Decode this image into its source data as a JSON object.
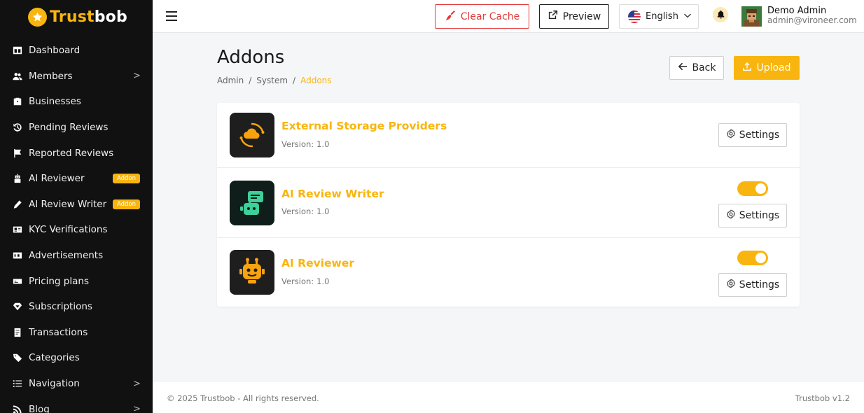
{
  "brand": {
    "part1": "Trust",
    "part2": "bob",
    "accent": "#f9b50f"
  },
  "sidebar": {
    "items": [
      {
        "label": "Dashboard",
        "icon": "dashboard-icon"
      },
      {
        "label": "Members",
        "icon": "members-icon",
        "chevron": ">"
      },
      {
        "label": "Businesses",
        "icon": "briefcase-icon"
      },
      {
        "label": "Pending Reviews",
        "icon": "history-icon"
      },
      {
        "label": "Reported Reviews",
        "icon": "flag-icon"
      },
      {
        "label": "AI Reviewer",
        "icon": "robot-icon",
        "badge": "Addon"
      },
      {
        "label": "AI Review Writer",
        "icon": "pen-icon",
        "badge": "Addon"
      },
      {
        "label": "KYC Verifications",
        "icon": "id-card-icon"
      },
      {
        "label": "Advertisements",
        "icon": "ad-icon"
      },
      {
        "label": "Pricing plans",
        "icon": "pricing-icon"
      },
      {
        "label": "Subscriptions",
        "icon": "diamond-icon"
      },
      {
        "label": "Transactions",
        "icon": "receipt-icon"
      },
      {
        "label": "Categories",
        "icon": "tags-icon"
      },
      {
        "label": "Navigation",
        "icon": "list-icon",
        "chevron": ">"
      },
      {
        "label": "Blog",
        "icon": "rss-icon",
        "chevron": ">"
      }
    ]
  },
  "topbar": {
    "clear_cache": "Clear Cache",
    "preview": "Preview",
    "language": "English",
    "user_name": "Demo Admin",
    "user_email": "admin@vironeer.com"
  },
  "page": {
    "title": "Addons",
    "breadcrumbs": [
      "Admin",
      "System",
      "Addons"
    ],
    "back": "Back",
    "upload": "Upload"
  },
  "addons": [
    {
      "name": "External Storage Providers",
      "version_label": "Version:",
      "version": "1.0",
      "settings": "Settings",
      "toggle": null
    },
    {
      "name": "AI Review Writer",
      "version_label": "Version:",
      "version": "1.0",
      "settings": "Settings",
      "toggle": true
    },
    {
      "name": "AI Reviewer",
      "version_label": "Version:",
      "version": "1.0",
      "settings": "Settings",
      "toggle": true
    }
  ],
  "footer": {
    "copyright": "© 2025 Trustbob - All rights reserved.",
    "version": "Trustbob v1.2"
  }
}
